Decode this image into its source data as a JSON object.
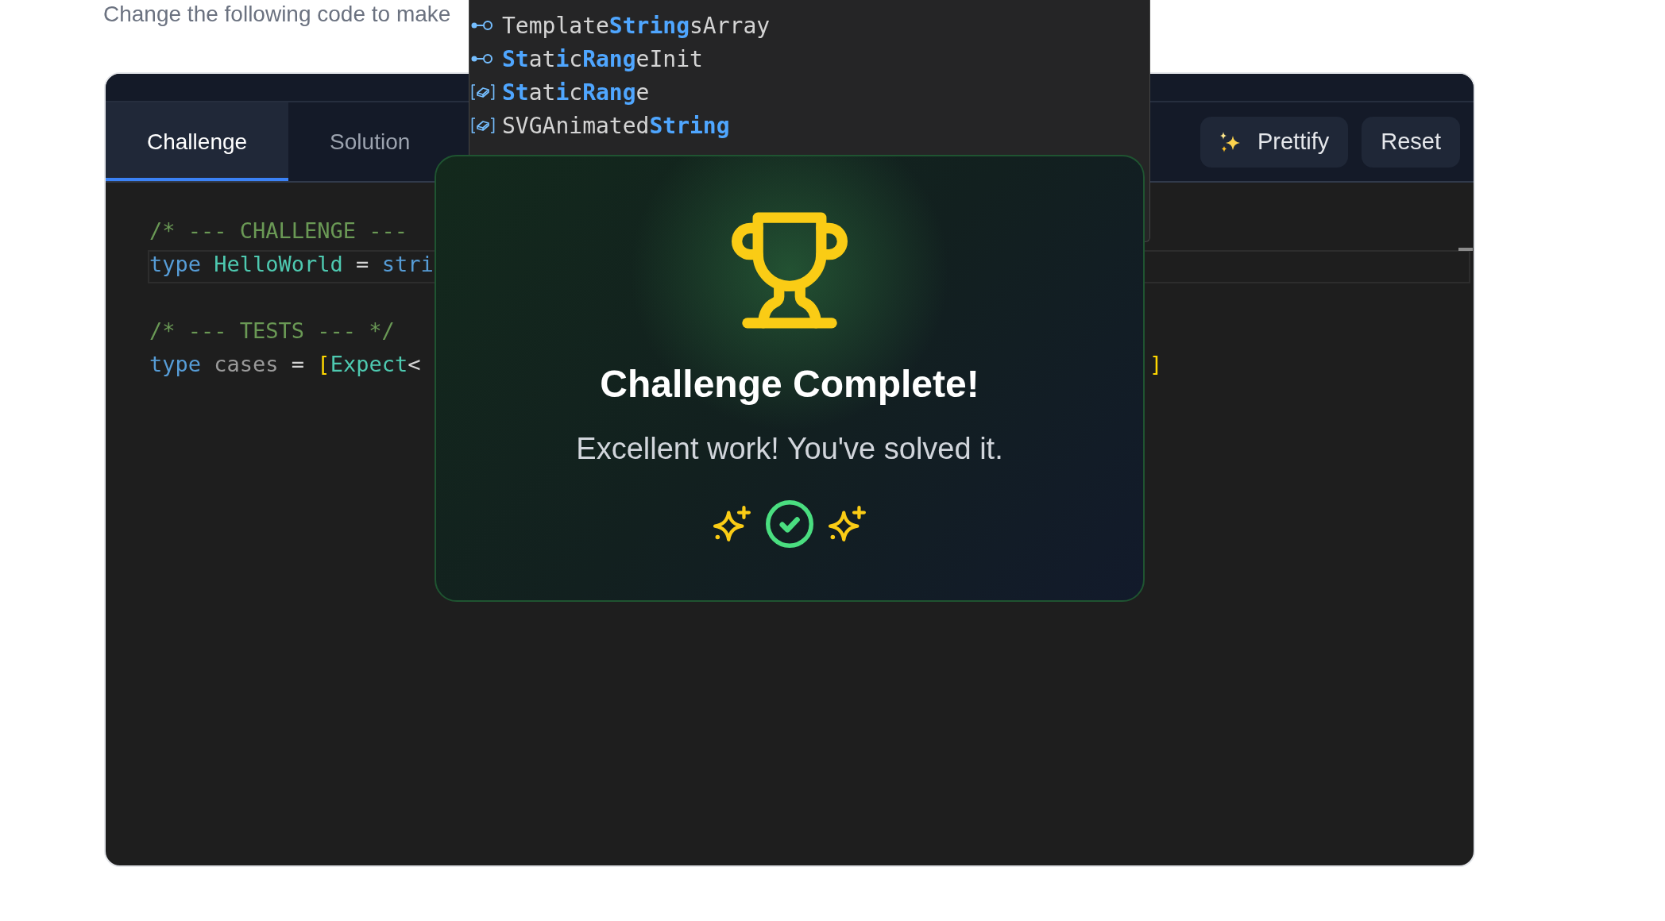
{
  "intro": {
    "text": "Change the following code to make"
  },
  "editor": {
    "tabs": [
      {
        "label": "Challenge",
        "selected": true
      },
      {
        "label": "Solution",
        "selected": false
      }
    ],
    "actions": [
      {
        "kind": "icon",
        "label": "Prettify"
      },
      {
        "kind": "plain",
        "label": "Reset"
      }
    ],
    "code_lines": [
      {
        "current": false,
        "tokens": [
          {
            "kind": "comment",
            "text": "/* --- CHALLENGE ---"
          }
        ]
      },
      {
        "current": true,
        "tokens": [
          {
            "kind": "keyword",
            "text": "type"
          },
          {
            "kind": "type",
            "text": " HelloWorld"
          },
          {
            "kind": "plain",
            "text": " = "
          },
          {
            "kind": "keyword",
            "text": "stri"
          }
        ]
      },
      {
        "current": false
      },
      {
        "current": false,
        "tokens": [
          {
            "kind": "comment",
            "text": "/* --- TESTS --- */"
          }
        ]
      },
      {
        "current": false,
        "tokens": [
          {
            "kind": "keyword",
            "text": "type"
          },
          {
            "kind": "dim",
            "text": " cases"
          },
          {
            "kind": "plain",
            "text": " = "
          },
          {
            "kind": "bracket",
            "text": "["
          },
          {
            "kind": "type",
            "text": "Expect"
          },
          {
            "kind": "plain",
            "text": "<"
          }
        ],
        "tail": [
          {
            "kind": "bracket",
            "text": "]"
          }
        ]
      }
    ]
  },
  "autocomplete": {
    "items": [
      {
        "kind": "interface",
        "label": "Template**String**sArray"
      },
      {
        "kind": "interface",
        "label": "**St**at**i**c**Rang**eInit"
      },
      {
        "kind": "class",
        "label": "**St**at**i**c**Rang**e"
      },
      {
        "kind": "class",
        "label": "SVGAnimated**String**"
      }
    ]
  },
  "dialog": {
    "title": "Challenge Complete!",
    "message": "Excellent work! You've solved it."
  }
}
